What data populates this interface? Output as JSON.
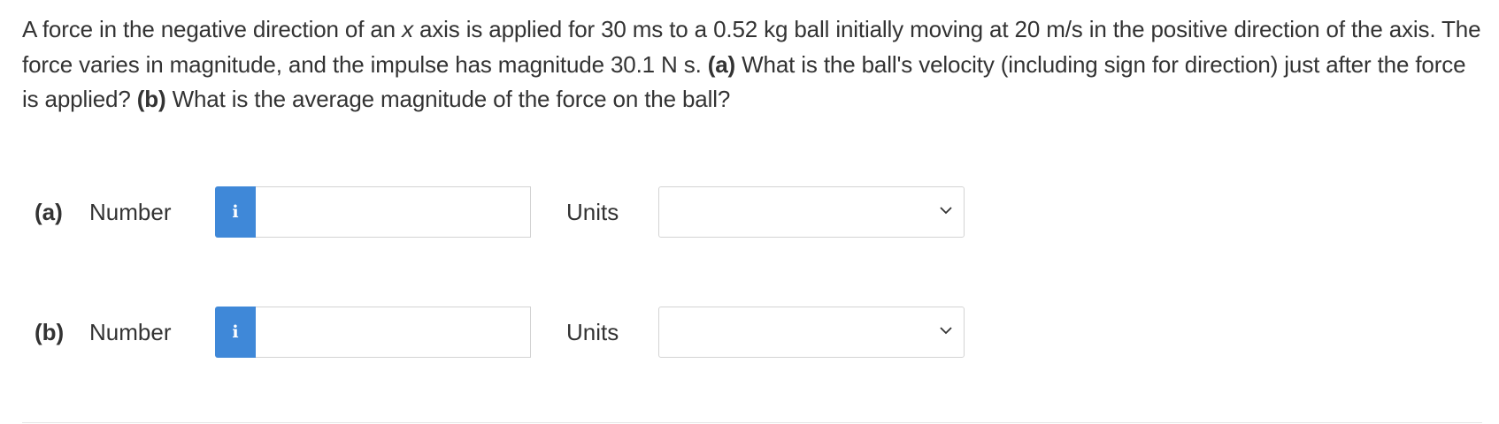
{
  "question": {
    "p1": "A force in the negative direction of an ",
    "var_x": "x",
    "p2": " axis is applied for 30 ms to a 0.52 kg ball initially moving at 20 m/s in the positive direction of the axis. The force varies in magnitude, and the impulse has magnitude 30.1 N s. ",
    "part_a_tag": "(a)",
    "part_a_text": " What is the ball's velocity (including sign for direction) just after the force is applied? ",
    "part_b_tag": "(b)",
    "part_b_text": " What is the average magnitude of the force on the ball?"
  },
  "answers": [
    {
      "part": "(a)",
      "number_label": "Number",
      "info_icon": "info-icon",
      "number_value": "",
      "units_label": "Units",
      "units_selected": ""
    },
    {
      "part": "(b)",
      "number_label": "Number",
      "info_icon": "info-icon",
      "number_value": "",
      "units_label": "Units",
      "units_selected": ""
    }
  ],
  "colors": {
    "info_button": "#3f88d8",
    "text": "#333333",
    "border": "#d3d3d3"
  }
}
